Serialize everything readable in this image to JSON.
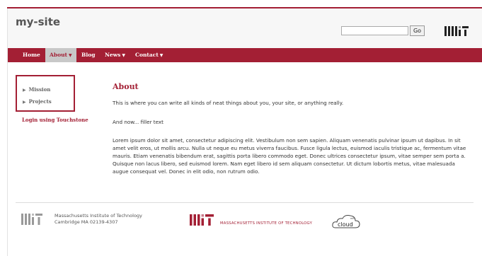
{
  "header": {
    "site_title": "my-site",
    "search_placeholder": "",
    "search_button": "Go",
    "logo": "mit-logo"
  },
  "nav": {
    "items": [
      {
        "label": "Home",
        "has_dropdown": false
      },
      {
        "label": "About",
        "has_dropdown": true,
        "active": true
      },
      {
        "label": "Blog",
        "has_dropdown": false
      },
      {
        "label": "News",
        "has_dropdown": true
      },
      {
        "label": "Contact",
        "has_dropdown": true
      }
    ],
    "dropdown_glyph": "▼"
  },
  "sidebar": {
    "items": [
      {
        "label": "Mission"
      },
      {
        "label": "Projects"
      }
    ],
    "arrow_glyph": "▶",
    "login_link": "Login using Touchstone"
  },
  "main": {
    "title": "About",
    "paragraphs": [
      "This is where you can write all kinds of neat things about you, your site, or anything really.",
      "And now... filler text",
      "Lorem ipsum dolor sit amet, consectetur adipiscing elit. Vestibulum non sem sapien. Aliquam venenatis pulvinar ipsum ut dapibus. In sit amet velit eros, ut mollis arcu. Nulla ut neque eu metus viverra faucibus. Fusce ligula lectus, euismod iaculis tristique ac, fermentum vitae mauris. Etiam venenatis bibendum erat, sagittis porta libero commodo eget. Donec ultrices consectetur ipsum, vitae semper sem porta a. Quisque non lacus libero, sed euismod lorem. Nam eget libero id sem aliquam consectetur. Ut dictum lobortis metus, vitae malesuada augue consequat vel. Donec in elit odio, non rutrum odio."
    ]
  },
  "footer": {
    "address_line1": "Massachusetts Institute of Technology",
    "address_line2": "Cambridge MA 02139-4307",
    "institute_text": "MASSACHUSETTS INSTITUTE OF TECHNOLOGY",
    "cloud_small": "mit",
    "cloud_word": "cloud"
  },
  "colors": {
    "brand": "#a31f34",
    "nav_active_bg": "#c8c8c8",
    "header_bg": "#f7f7f7"
  }
}
